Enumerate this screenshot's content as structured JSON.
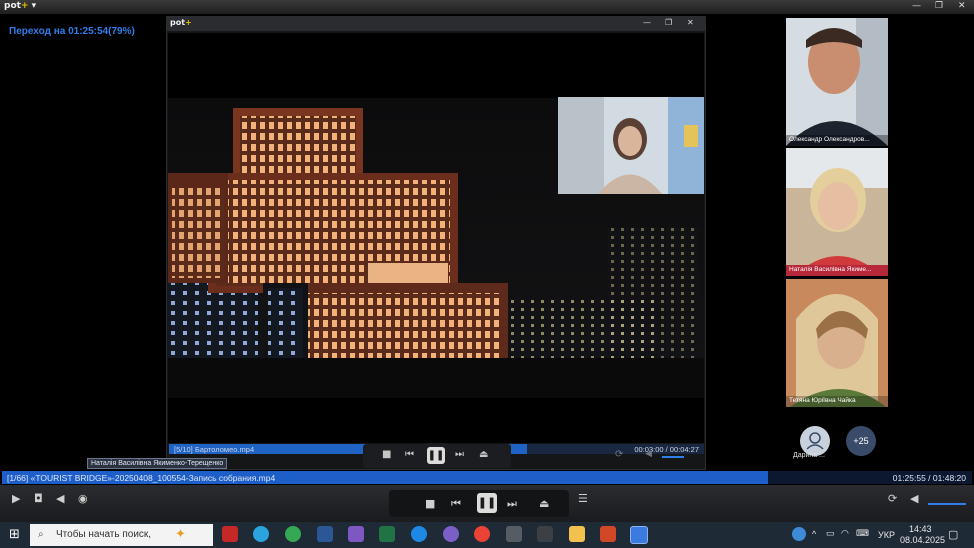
{
  "outer_player": {
    "logo_prefix": "pot",
    "logo_suffix": "+",
    "jump_status": "Переход на 01:25:54(79%)",
    "playlist_entry": "[1/66] «TOURIST BRIDGE»-20250408_100554-Запись собрания.mp4",
    "time": "01:25:55 / 01:48:20",
    "progress_fraction": 0.79,
    "hover_tooltip": "Наталія Василівна Якименко-Терещенко"
  },
  "inner_player": {
    "logo_prefix": "pot",
    "logo_suffix": "+",
    "playlist_entry": "[5/10] Бартоломео.mp4",
    "time": "00:03:00 / 00:04:27",
    "progress_fraction": 0.67
  },
  "participants": [
    {
      "name": "Олександр Олександров..."
    },
    {
      "name": "Наталія Василівна Якиме..."
    },
    {
      "name": "Тетяна Юріївна Чайка"
    }
  ],
  "participant_avatar": {
    "name": "Дарина ..."
  },
  "more_participants": "+25",
  "taskbar": {
    "search_placeholder": "Чтобы начать поиск,",
    "language": "УКР",
    "clock_time": "14:43",
    "clock_date": "08.04.2025"
  },
  "colors": {
    "accent_blue": "#1e5ec8",
    "timeline_bg": "#0c1830",
    "taskbar_bg": "#1f2a37"
  }
}
